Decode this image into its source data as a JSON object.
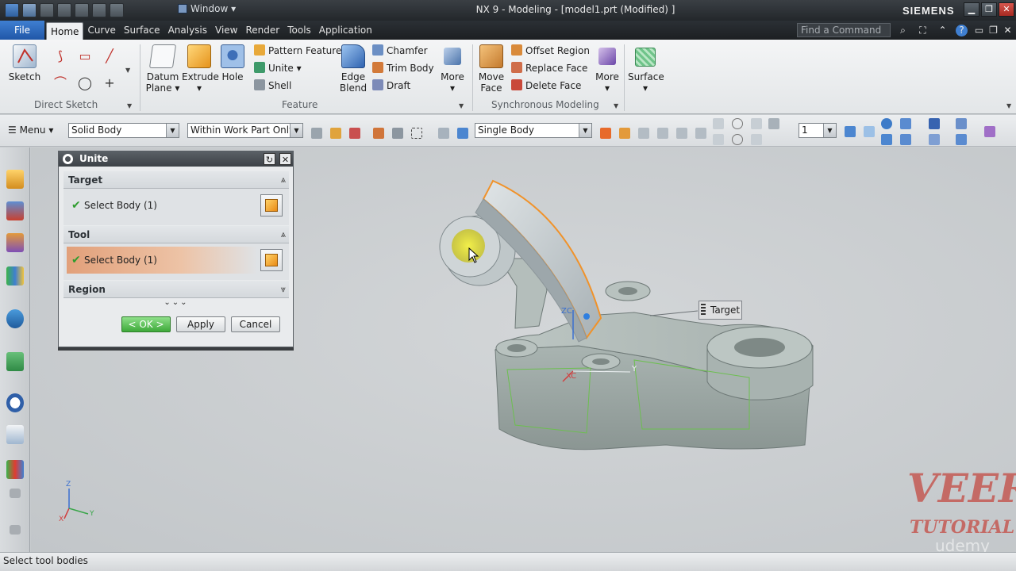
{
  "window": {
    "menu_label": "Window",
    "title": "NX 9 - Modeling - [model1.prt (Modified) ]",
    "brand": "SIEMENS"
  },
  "menubar": {
    "file": "File",
    "tabs": [
      "Home",
      "Curve",
      "Surface",
      "Analysis",
      "View",
      "Render",
      "Tools",
      "Application"
    ],
    "active_tab": "Home",
    "find_placeholder": "Find a Command"
  },
  "ribbon": {
    "direct_sketch": {
      "label": "Direct Sketch",
      "sketch": "Sketch"
    },
    "feature": {
      "label": "Feature",
      "datum_plane_1": "Datum",
      "datum_plane_2": "Plane",
      "extrude": "Extrude",
      "hole": "Hole",
      "pattern_feature": "Pattern Feature",
      "unite": "Unite",
      "shell": "Shell",
      "edge_blend_1": "Edge",
      "edge_blend_2": "Blend",
      "chamfer": "Chamfer",
      "trim_body": "Trim Body",
      "draft": "Draft",
      "more": "More"
    },
    "synchronous": {
      "label": "Synchronous Modeling",
      "move_face_1": "Move",
      "move_face_2": "Face",
      "offset_region": "Offset Region",
      "replace_face": "Replace Face",
      "delete_face": "Delete Face",
      "more": "More"
    },
    "surface": "Surface"
  },
  "selection_bar": {
    "menu": "Menu",
    "type_filter": "Solid Body",
    "scope": "Within Work Part Only",
    "body_rule": "Single Body",
    "layer": "1"
  },
  "dialog": {
    "title": "Unite",
    "target_header": "Target",
    "target_select": "Select Body (1)",
    "tool_header": "Tool",
    "tool_select": "Select Body (1)",
    "region_header": "Region",
    "ok": "< OK >",
    "apply": "Apply",
    "cancel": "Cancel"
  },
  "viewport": {
    "callout": "Target",
    "axis_zc": "ZC",
    "axis_xc": "XC",
    "axis_y": "Y",
    "triad_z": "Z",
    "triad_x": "X",
    "triad_y": "Y"
  },
  "watermark": {
    "line1": "VEER",
    "line2": "TUTORIAL",
    "line3": "udemy"
  },
  "status": "Select tool bodies",
  "colors": {
    "accent": "#2057a8",
    "selection": "#f0922a",
    "ok_green": "#3ea93a",
    "part_body": "#9aa5a2",
    "arc_body": "#c6cdd1"
  }
}
